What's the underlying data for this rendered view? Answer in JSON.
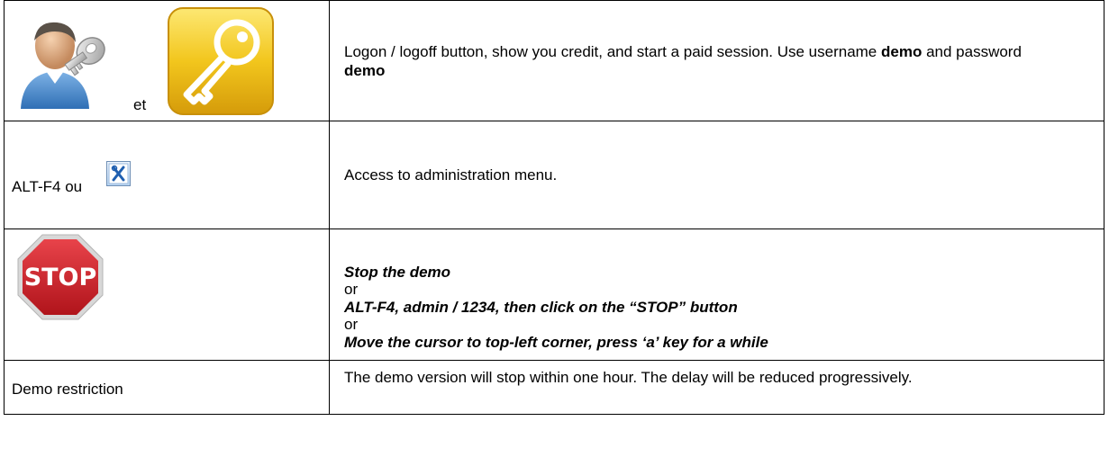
{
  "rows": [
    {
      "left": {
        "icons": [
          "user-key-icon",
          "gold-key-icon"
        ],
        "connector": "et"
      },
      "right": {
        "text_before": "Logon / logoff button, show you credit, and start a paid session. Use username ",
        "bold1": "demo",
        "text_middle": " and password ",
        "bold2": "demo"
      }
    },
    {
      "left": {
        "label": "ALT-F4  ou",
        "icon": "admin-tools-icon"
      },
      "right": {
        "text": "Access to administration menu."
      }
    },
    {
      "left": {
        "icon": "stop-sign-icon",
        "icon_text": "STOP"
      },
      "right": {
        "line1": "Stop the demo",
        "or1": "or",
        "line2": "ALT-F4, admin / 1234, then click on the  “STOP” button",
        "or2": "or",
        "line3": "Move the cursor to top-left corner, press ‘a’ key for a while"
      }
    },
    {
      "left": {
        "label": "Demo restriction"
      },
      "right": {
        "text": "The demo version will stop within one hour. The delay will be reduced progressively."
      }
    }
  ],
  "colors": {
    "stop_red": "#d0232a",
    "gold": "#f2c61d",
    "border": "#000000"
  }
}
